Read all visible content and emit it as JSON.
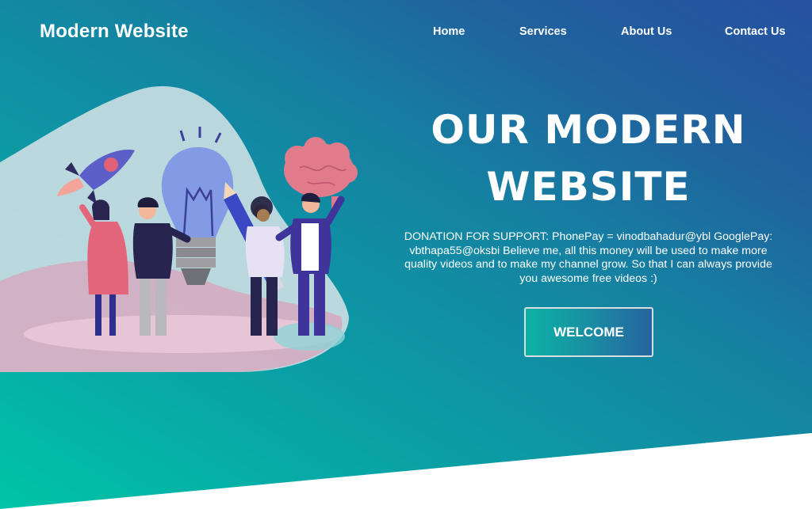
{
  "header": {
    "logo": "Modern Website",
    "nav": [
      {
        "label": "Home"
      },
      {
        "label": "Services"
      },
      {
        "label": "About Us"
      },
      {
        "label": "Contact Us"
      }
    ]
  },
  "hero": {
    "title_line1": "OUR MODERN",
    "title_line2": "WEBSITE",
    "description": "DONATION FOR SUPPORT: PhonePay = vinodbahadur@ybl GooglePay: vbthapa55@oksbi Believe me, all this money will be used to make more quality videos and to make my channel grow. So that I can always provide you awesome free videos :)",
    "button_label": "WELCOME"
  },
  "colors": {
    "gradient_start": "#00c4a8",
    "gradient_end": "#2650a0",
    "text": "#ffffff",
    "bottom_band": "#ffffff"
  },
  "illustration": {
    "icons": [
      "rocket-icon",
      "lightbulb-icon",
      "pencil-icon",
      "brain-icon"
    ],
    "people_count": 4
  }
}
